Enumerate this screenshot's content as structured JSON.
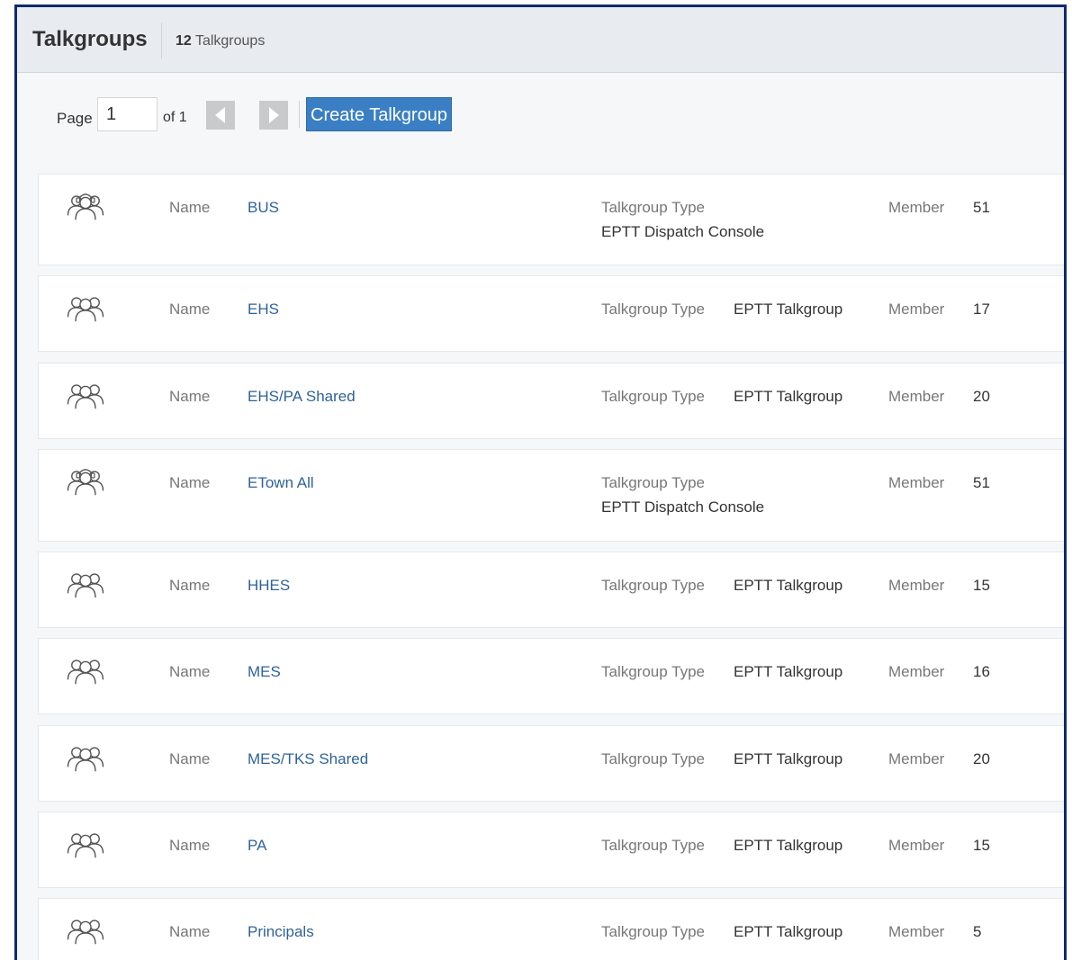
{
  "header": {
    "title": "Talkgroups",
    "count": "12",
    "count_label": "Talkgroups"
  },
  "pager": {
    "page_label": "Page",
    "current_page": "1",
    "of_label": "of 1",
    "create_label": "Create Talkgroup"
  },
  "labels": {
    "name": "Name",
    "type": "Talkgroup Type",
    "member": "Member"
  },
  "rows": [
    {
      "name": "BUS",
      "type": "EPTT Dispatch Console",
      "member": "51",
      "icon": "dispatch-console-group-icon"
    },
    {
      "name": "EHS",
      "type": "EPTT Talkgroup",
      "member": "17",
      "icon": "talkgroup-icon"
    },
    {
      "name": "EHS/PA Shared",
      "type": "EPTT Talkgroup",
      "member": "20",
      "icon": "talkgroup-icon"
    },
    {
      "name": "ETown All",
      "type": "EPTT Dispatch Console",
      "member": "51",
      "icon": "dispatch-console-group-icon"
    },
    {
      "name": "HHES",
      "type": "EPTT Talkgroup",
      "member": "15",
      "icon": "talkgroup-icon"
    },
    {
      "name": "MES",
      "type": "EPTT Talkgroup",
      "member": "16",
      "icon": "talkgroup-icon"
    },
    {
      "name": "MES/TKS Shared",
      "type": "EPTT Talkgroup",
      "member": "20",
      "icon": "talkgroup-icon"
    },
    {
      "name": "PA",
      "type": "EPTT Talkgroup",
      "member": "15",
      "icon": "talkgroup-icon"
    },
    {
      "name": "Principals",
      "type": "EPTT Talkgroup",
      "member": "5",
      "icon": "talkgroup-icon"
    }
  ]
}
